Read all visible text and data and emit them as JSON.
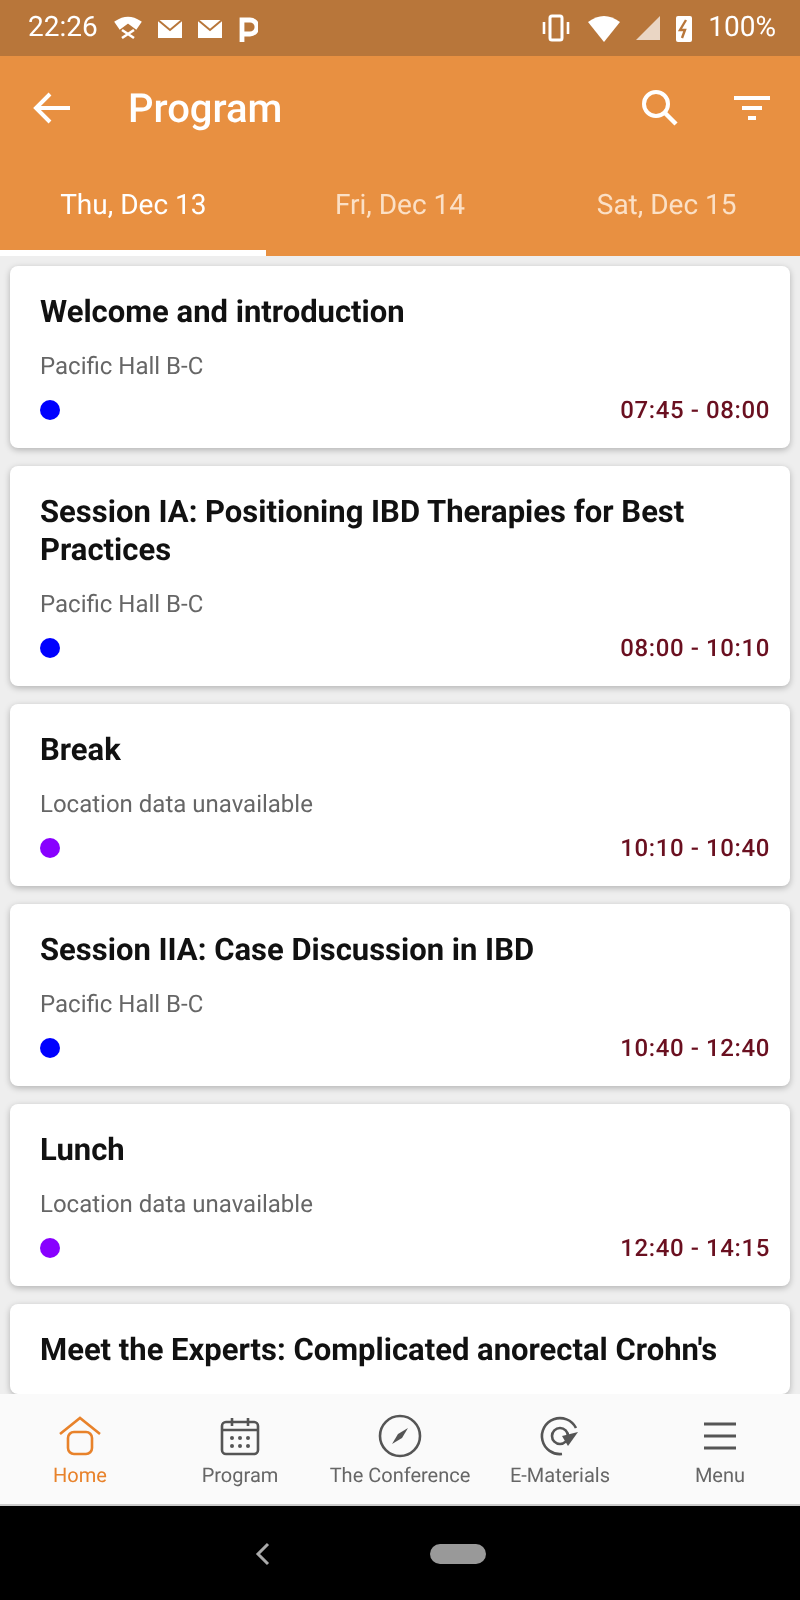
{
  "status_bar": {
    "time": "22:26",
    "battery": "100%"
  },
  "toolbar": {
    "title": "Program"
  },
  "tabs": [
    {
      "label": "Thu, Dec 13",
      "selected": true
    },
    {
      "label": "Fri, Dec 14",
      "selected": false
    },
    {
      "label": "Sat, Dec 15",
      "selected": false
    }
  ],
  "sessions": [
    {
      "title": "Welcome and introduction",
      "location": "Pacific Hall B-C",
      "time": "07:45 - 08:00",
      "color": "#0000ff"
    },
    {
      "title": "Session IA: Positioning IBD Therapies for Best Practices",
      "location": "Pacific Hall B-C",
      "time": "08:00 - 10:10",
      "color": "#0000ff"
    },
    {
      "title": "Break",
      "location": "Location data unavailable",
      "time": "10:10 - 10:40",
      "color": "#8800ff"
    },
    {
      "title": "Session IIA: Case Discussion in IBD",
      "location": "Pacific Hall B-C",
      "time": "10:40 - 12:40",
      "color": "#0000ff"
    },
    {
      "title": "Lunch",
      "location": "Location data unavailable",
      "time": "12:40 - 14:15",
      "color": "#8800ff"
    },
    {
      "title": "Meet the Experts: Complicated anorectal Crohn's"
    }
  ],
  "bottom_nav": [
    {
      "label": "Home",
      "kind": "home",
      "selected": true
    },
    {
      "label": "Program",
      "kind": "calendar",
      "selected": false
    },
    {
      "label": "The Conference",
      "kind": "compass",
      "selected": false
    },
    {
      "label": "E-Materials",
      "kind": "materials",
      "selected": false
    },
    {
      "label": "Menu",
      "kind": "menu",
      "selected": false
    }
  ]
}
